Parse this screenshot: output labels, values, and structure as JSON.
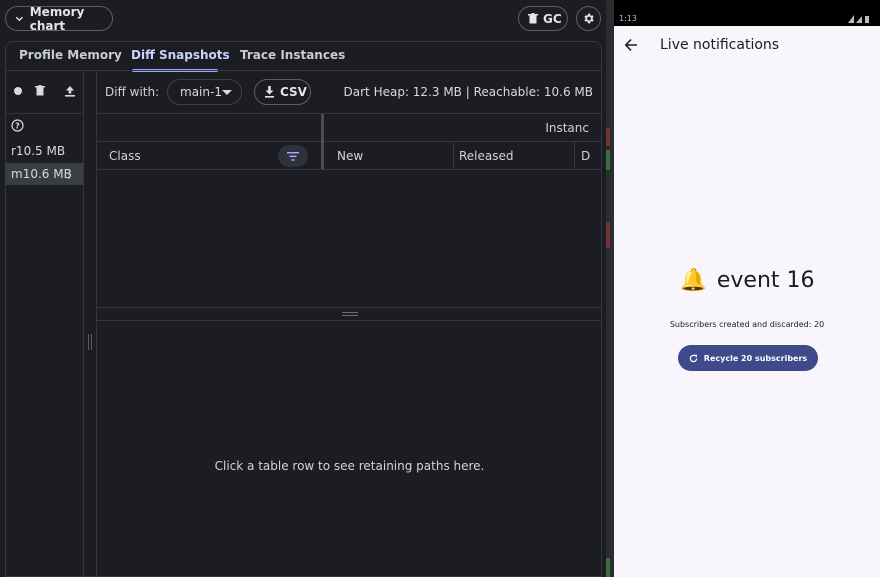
{
  "devtools": {
    "memory_chart_label": "Memory chart",
    "gc_label": "GC",
    "tabs": [
      {
        "label": "Profile Memory"
      },
      {
        "label": "Diff Snapshots"
      },
      {
        "label": "Trace Instances"
      }
    ],
    "active_tab": "Diff Snapshots",
    "help_glyph": "?",
    "snapshots": [
      {
        "label": "r10.5 MB"
      },
      {
        "label": "m10.6 MB",
        "selected": true
      }
    ],
    "snapshot_menu_glyph": "⋮",
    "diff_with_label": "Diff with:",
    "diff_with_value": "main-1",
    "csv_label": "CSV",
    "heap_info": "Dart Heap: 12.3 MB | Reachable: 10.6 MB",
    "table": {
      "group_header": "Instanc",
      "columns": [
        "Class",
        "New",
        "Released",
        "D"
      ]
    },
    "retaining_paths_message": "Click a table row to see retaining paths here."
  },
  "phone": {
    "status_time": "1:13",
    "title": "Live notifications",
    "event_text": "event 16",
    "event_icon": "bell",
    "event_emoji": "🔔",
    "subscribers_text": "Subscribers created and discarded: 20",
    "recycle_button": "Recycle 20 subscribers"
  }
}
